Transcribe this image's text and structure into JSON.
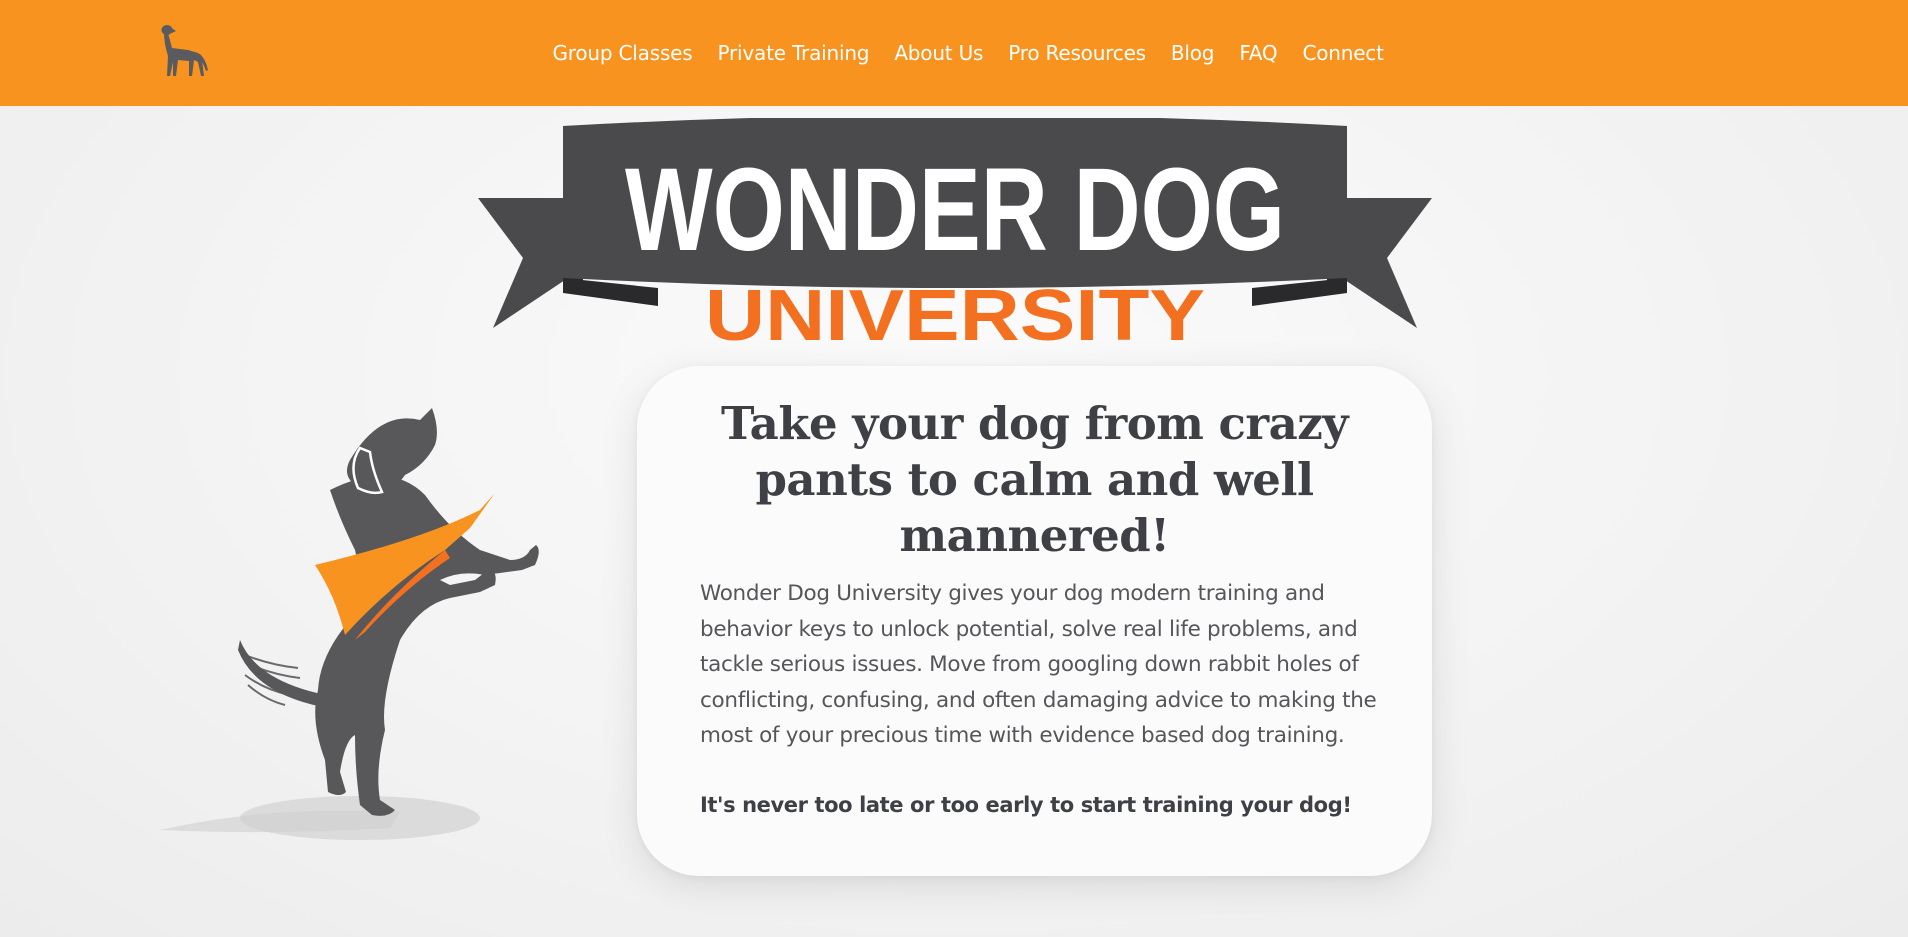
{
  "header": {
    "background_color": "#f7931e",
    "logo_icon": "dog-silhouette-icon",
    "nav": [
      {
        "label": "Group Classes"
      },
      {
        "label": "Private Training"
      },
      {
        "label": "About Us"
      },
      {
        "label": "Pro Resources"
      },
      {
        "label": "Blog"
      },
      {
        "label": "FAQ"
      },
      {
        "label": "Connect"
      }
    ]
  },
  "brand": {
    "title_line1": "WONDER DOG",
    "title_line2": "UNIVERSITY",
    "title_line1_color": "#ffffff",
    "title_line2_color": "#f37021",
    "ribbon_color": "#4a4a4c"
  },
  "hero": {
    "illustration": "caped-dog-illustration",
    "cape_color": "#f7931e",
    "dog_color": "#58585a"
  },
  "card": {
    "title": "Take your dog from crazy pants to calm and well mannered!",
    "body": "Wonder Dog University gives your dog modern training and behavior keys to unlock potential, solve real life problems, and tackle serious issues. Move from googling down rabbit holes of conflicting, confusing, and often damaging advice to making the most of your precious time with evidence based dog training.",
    "emphasis": "It's never too late or too early to start training your dog!"
  }
}
